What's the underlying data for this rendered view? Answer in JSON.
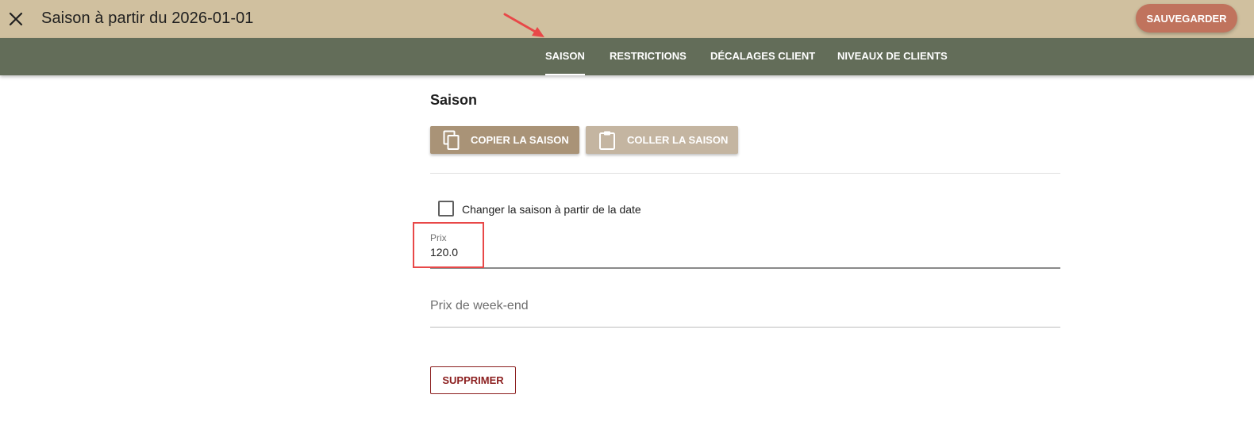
{
  "header": {
    "title": "Saison à partir du 2026-01-01",
    "close_icon": "close-icon",
    "save_label": "SAUVEGARDER",
    "save_color": "#c0735d",
    "bar_color": "#d0c09f"
  },
  "tabs": {
    "bar_color": "#636d59",
    "items": [
      {
        "label": "SAISON",
        "active": true
      },
      {
        "label": "RESTRICTIONS",
        "active": false
      },
      {
        "label": "DÉCALAGES CLIENT",
        "active": false
      },
      {
        "label": "NIVEAUX DE CLIENTS",
        "active": false
      }
    ]
  },
  "section": {
    "title": "Saison",
    "copy_label": "COPIER LA SAISON",
    "copy_icon": "copy-icon",
    "paste_label": "COLLER LA SAISON",
    "paste_icon": "clipboard-icon"
  },
  "form": {
    "change_season_label": "Changer la saison à partir de la date",
    "change_season_checked": false,
    "price_label": "Prix",
    "price_value": "120.0",
    "weekend_price_placeholder": "Prix de week-end",
    "delete_label": "SUPPRIMER"
  },
  "annotations": {
    "arrow_color": "#e84848",
    "highlight_color": "#e84848"
  }
}
